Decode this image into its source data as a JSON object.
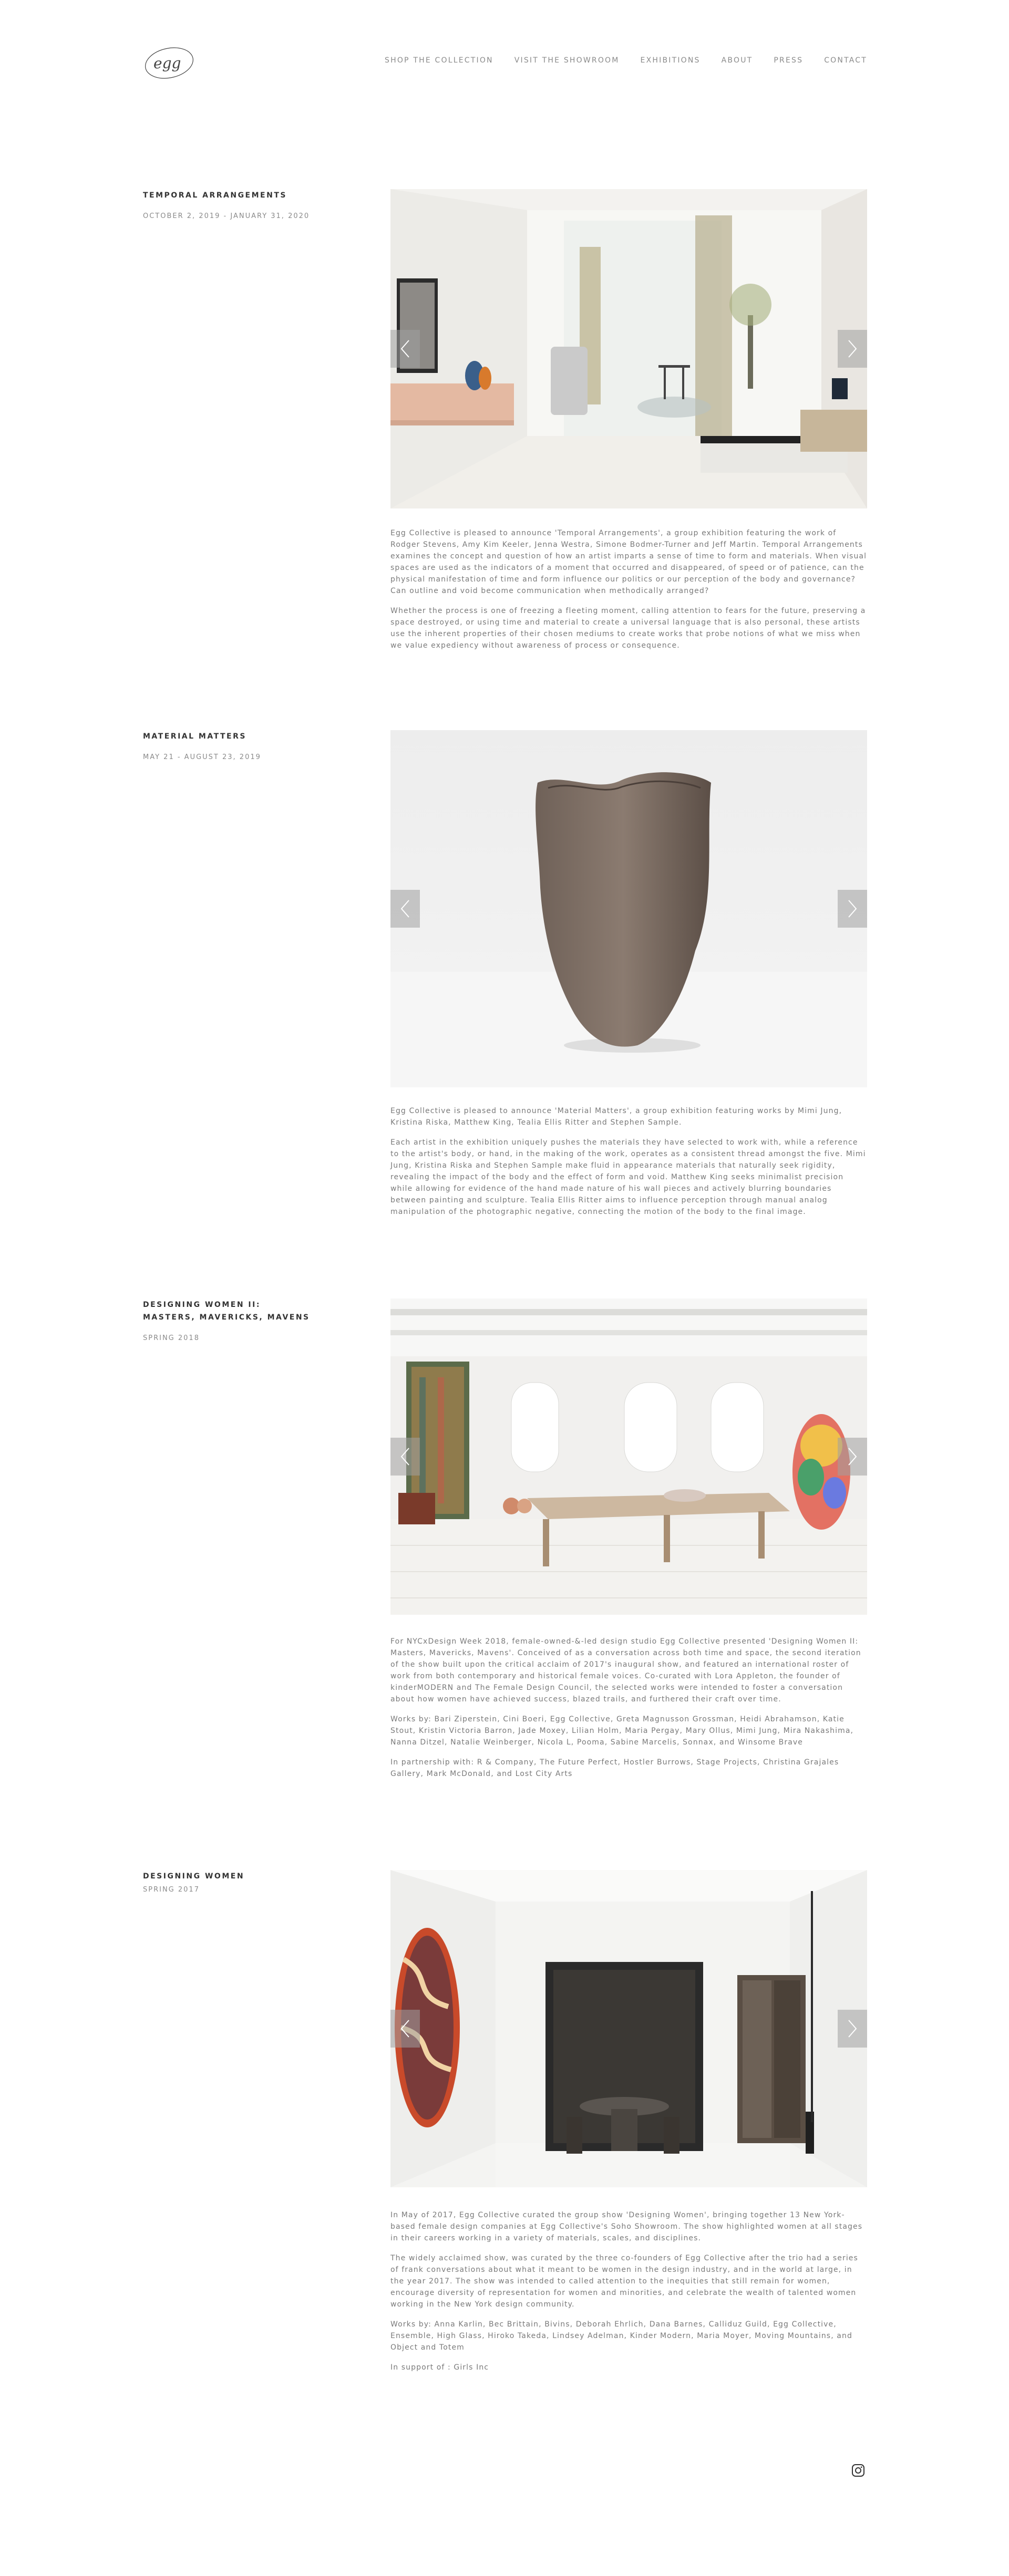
{
  "logo": {
    "text": "egg"
  },
  "nav": [
    {
      "label": "SHOP THE COLLECTION"
    },
    {
      "label": "VISIT THE SHOWROOM"
    },
    {
      "label": "EXHIBITIONS"
    },
    {
      "label": "ABOUT"
    },
    {
      "label": "PRESS"
    },
    {
      "label": "CONTACT"
    }
  ],
  "exhibitions": [
    {
      "title_line1": "TEMPORAL ARRANGEMENTS",
      "title_line2": "",
      "date": "OCTOBER 2, 2019 - JANUARY 31, 2020",
      "paragraphs": [
        "Egg Collective is pleased to announce 'Temporal Arrangements', a group exhibition featuring the work of Rodger Stevens, Amy Kim Keeler, Jenna Westra, Simone Bodmer-Turner and Jeff Martin. Temporal Arrangements examines the concept and question of how an artist imparts a sense of time to form and materials. When visual spaces are used as the indicators of a moment that occurred and disappeared, of speed or of patience, can the physical manifestation of time and form influence our politics or our perception of the body and governance? Can outline and void become communication when methodically arranged?",
        "Whether the process is one of freezing a fleeting moment, calling attention to fears for the future, preserving a space destroyed, or using time and material to create a universal language that is also personal, these artists use the inherent properties of their chosen mediums to create works that probe notions of what we miss when we value expediency without awareness of process or consequence."
      ]
    },
    {
      "title_line1": "MATERIAL MATTERS",
      "title_line2": "",
      "date": "MAY 21 - AUGUST 23, 2019",
      "paragraphs": [
        "Egg Collective is pleased to announce 'Material Matters', a group exhibition featuring works by Mimi Jung, Kristina Riska, Matthew King, Tealia Ellis Ritter and Stephen Sample.",
        "Each artist in the exhibition uniquely pushes the materials they have selected to work with, while a reference to the artist's body, or hand, in the making of the work, operates as a consistent thread amongst the five. Mimi Jung, Kristina Riska and Stephen Sample make fluid in appearance materials that naturally seek rigidity, revealing the impact of the body and the effect of form and void. Matthew King seeks minimalist precision while allowing for evidence of the hand made nature of his wall pieces and actively blurring boundaries between painting and sculpture. Tealia Ellis Ritter aims to influence perception through manual analog manipulation of the photographic negative, connecting the motion of the body to the final image."
      ]
    },
    {
      "title_line1": "DESIGNING WOMEN II:",
      "title_line2": "MASTERS, MAVERICKS, MAVENS",
      "date": "SPRING 2018",
      "paragraphs": [
        "For NYCxDesign Week 2018, female-owned-&-led design studio Egg Collective presented 'Designing Women II: Masters, Mavericks, Mavens'. Conceived of as a conversation across both time and space, the second iteration of the show built upon the critical acclaim of 2017's inaugural show, and featured an international roster of work from both contemporary and historical female voices. Co-curated with Lora Appleton, the founder of kinderMODERN and The Female Design Council, the selected works were intended to foster a conversation about how women have achieved success, blazed trails, and furthered their craft over time.",
        "Works by: Bari Ziperstein, Cini Boeri, Egg Collective, Greta Magnusson Grossman, Heidi Abrahamson, Katie Stout, Kristin Victoria Barron, Jade Moxey, Lilian Holm, Maria Pergay, Mary Ollus, Mimi Jung, Mira Nakashima, Nanna Ditzel, Natalie Weinberger, Nicola L, Pooma, Sabine Marcelis, Sonnax, and Winsome Brave",
        "In partnership with: R & Company, The Future Perfect, Hostler Burrows, Stage Projects, Christina Grajales Gallery, Mark McDonald, and Lost City Arts"
      ]
    },
    {
      "title_line1": "DESIGNING WOMEN",
      "title_line2": "",
      "date": "SPRING 2017",
      "paragraphs": [
        "In May of 2017, Egg Collective curated the group show 'Designing Women', bringing together 13 New York-based female design companies at Egg Collective's Soho Showroom. The show highlighted women at all stages in their careers working in a variety of materials, scales, and disciplines.",
        "The widely acclaimed show, was curated by the three co-founders of Egg Collective after the trio had a series of frank conversations about what it meant to be women in the design industry, and in the world at large, in the year 2017. The show was intended to called attention to the inequities that still remain for women, encourage diversity of representation for women and minorities, and celebrate the wealth of talented women working in the New York design community.",
        "Works by: Anna Karlin, Bec Brittain, Bivins, Deborah Ehrlich, Dana Barnes, Calliduz Guild, Egg Collective, Ensemble, High Glass, Hiroko Takeda, Lindsey Adelman, Kinder Modern, Maria Moyer, Moving Mountains, and Object and Totem",
        "In support of : Girls Inc"
      ]
    }
  ],
  "footer": {
    "social_icon": "instagram-icon"
  }
}
